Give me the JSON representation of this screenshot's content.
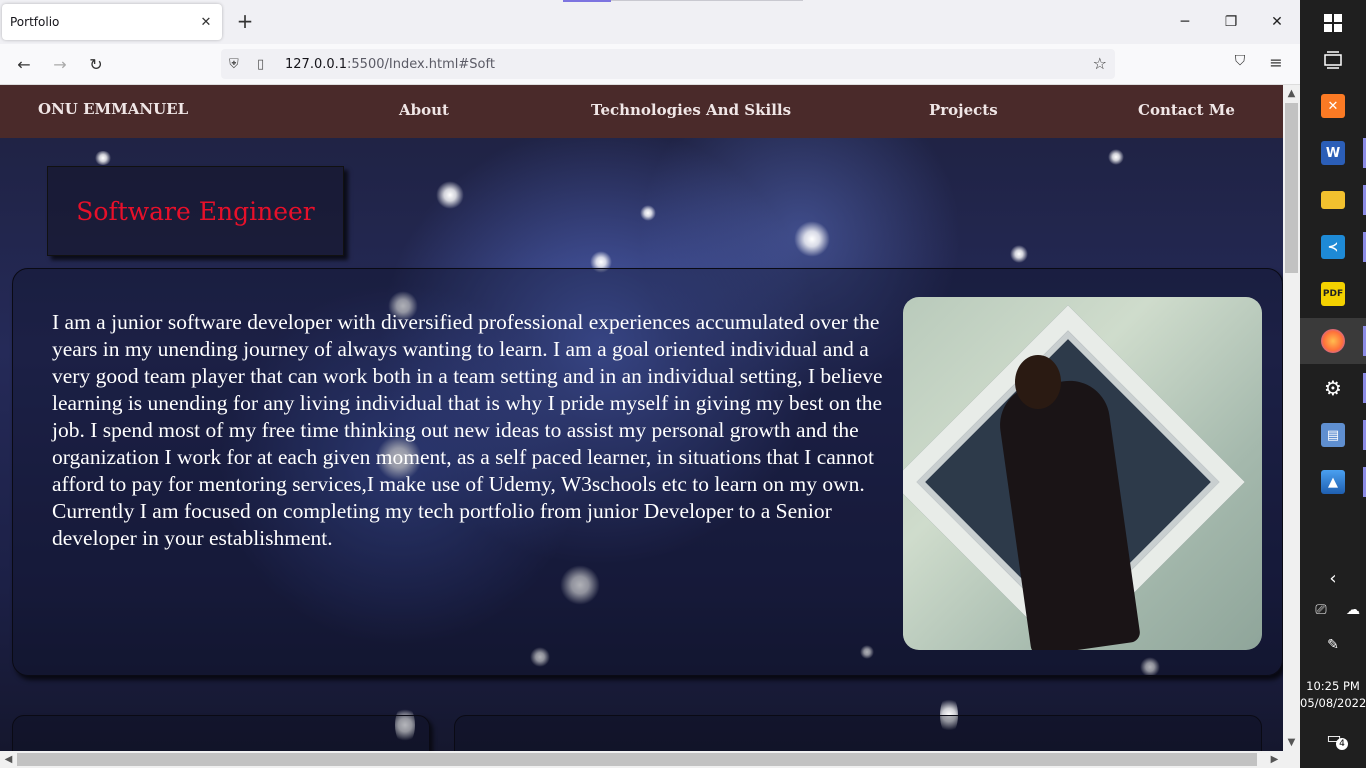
{
  "browser": {
    "tab": {
      "title": "Portfolio",
      "close_glyph": "✕"
    },
    "new_tab_glyph": "+",
    "url": {
      "host": "127.0.0.1",
      "rest": ":5500/Index.html#Soft"
    },
    "window_controls": {
      "minimize": "─",
      "restore": "❐",
      "close": "✕"
    },
    "nav": {
      "back": "←",
      "forward": "→",
      "reload": "↻",
      "star": "☆",
      "pocket": "⛉",
      "menu": "≡"
    }
  },
  "site": {
    "brand": "ONU EMMANUEL",
    "nav": [
      {
        "label": "About"
      },
      {
        "label": "Technologies And Skills"
      },
      {
        "label": "Projects"
      },
      {
        "label": "Contact Me"
      }
    ],
    "title": "Software Engineer",
    "about": "I am a junior software developer with diversified professional experiences accumulated over the years in my unending journey of always wanting to learn. I am a goal oriented individual and a very good team player that can work both in a team setting and in an individual setting, I believe learning is unending for any living individual that is why I pride myself in giving my best on the job. I spend most of my free time thinking out new ideas to assist my personal growth and the organization I work for at each given moment, as a self paced learner, in situations that I cannot afford to pay for mentoring services,I make use of Udemy, W3schools etc to learn on my own. Currently I am focused on completing my tech portfolio from junior Developer to a Senior developer in your establishment.",
    "colors": {
      "header_bg": "#4a2a2a",
      "title_red": "#e8102a"
    }
  },
  "taskbar": {
    "icons": [
      "windows-start-icon",
      "task-view-icon",
      "xampp-icon",
      "word-icon",
      "file-explorer-icon",
      "vscode-icon",
      "pdf-icon",
      "firefox-icon",
      "settings-icon",
      "network-icon",
      "photos-icon"
    ],
    "pdf_label": "PDF",
    "word_label": "W",
    "clock": {
      "time": "10:25 PM",
      "date": "05/08/2022"
    },
    "notification_count": "4",
    "chevron": "‹"
  }
}
